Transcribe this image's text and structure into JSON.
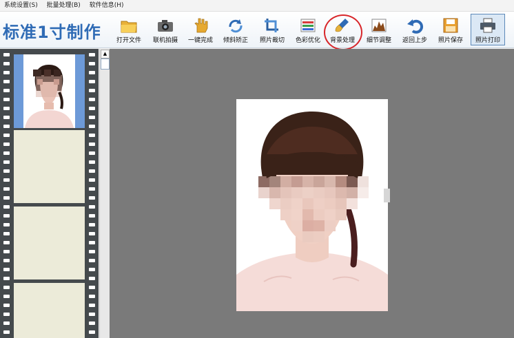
{
  "menu": {
    "items": [
      "系统设置(S)",
      "批量处理(B)",
      "软件信息(H)"
    ]
  },
  "app": {
    "title": "标准1寸制作"
  },
  "toolbar": {
    "buttons": [
      {
        "label": "打开文件",
        "icon": "folder-icon"
      },
      {
        "label": "联机拍摄",
        "icon": "camera-icon"
      },
      {
        "label": "一键完成",
        "icon": "hand-icon"
      },
      {
        "label": "倾斜矫正",
        "icon": "rotate-icon"
      },
      {
        "label": "照片裁切",
        "icon": "crop-icon"
      },
      {
        "label": "色彩优化",
        "icon": "color-bars-icon"
      },
      {
        "label": "背景处理",
        "icon": "brush-icon"
      },
      {
        "label": "细节调整",
        "icon": "histogram-icon"
      },
      {
        "label": "返回上步",
        "icon": "undo-icon"
      },
      {
        "label": "照片保存",
        "icon": "save-icon"
      },
      {
        "label": "照片打印",
        "icon": "printer-icon"
      }
    ],
    "highlighted": "背景处理",
    "active": "照片打印"
  },
  "colors": {
    "title_blue": "#2f6bb5",
    "highlight_red": "#d8262a",
    "film_dark": "#454a4d",
    "frame_selected": "#6d9ad8",
    "frame_empty": "#ecebd9",
    "canvas_gray": "#7a7a7a"
  }
}
